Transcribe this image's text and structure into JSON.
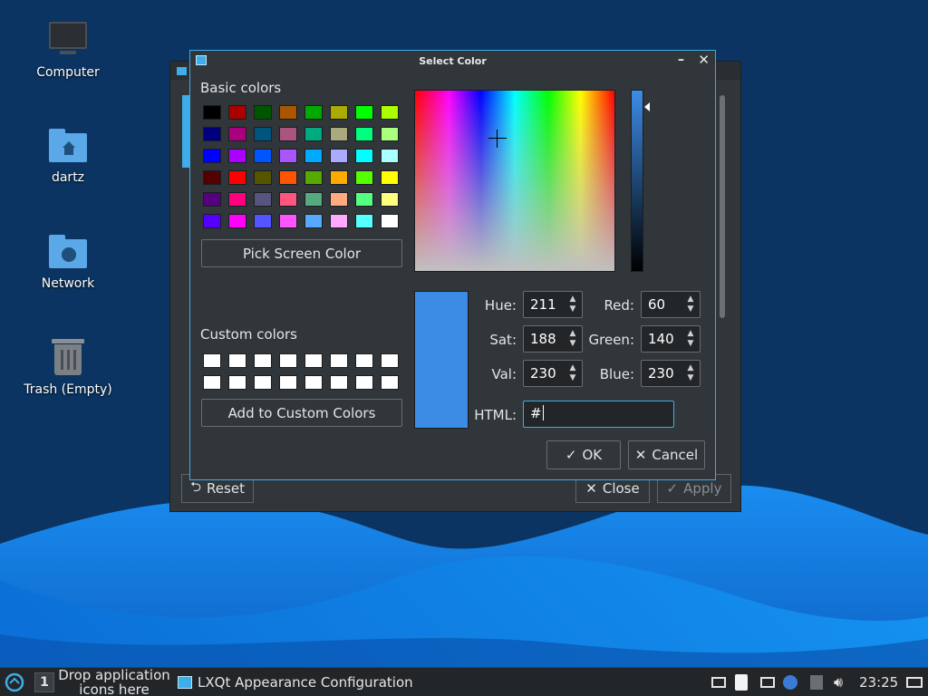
{
  "desktop": {
    "icons": [
      {
        "label": "Computer",
        "icon": "computer-icon"
      },
      {
        "label": "dartz",
        "icon": "home-folder-icon"
      },
      {
        "label": "Network",
        "icon": "network-folder-icon"
      },
      {
        "label": "Trash (Empty)",
        "icon": "trash-icon"
      }
    ]
  },
  "background_window": {
    "title": "LXQt Appearance Configuration",
    "reset_label": "Reset",
    "close_label": "Close",
    "apply_label": "Apply"
  },
  "dialog": {
    "title": "Select Color",
    "basic_colors_label": "Basic colors",
    "basic_colors": [
      "#000000",
      "#aa0000",
      "#005500",
      "#aa5500",
      "#00aa00",
      "#aaaa00",
      "#00ff00",
      "#aaff00",
      "#00007f",
      "#aa007f",
      "#00557f",
      "#aa557f",
      "#00aa7f",
      "#aaaa7f",
      "#00ff7f",
      "#aaff7f",
      "#0000ff",
      "#aa00ff",
      "#0055ff",
      "#aa55ff",
      "#00aaff",
      "#aaaaff",
      "#00ffff",
      "#aaffff",
      "#550000",
      "#ff0000",
      "#555500",
      "#ff5500",
      "#55aa00",
      "#ffaa00",
      "#55ff00",
      "#ffff00",
      "#55007f",
      "#ff007f",
      "#55557f",
      "#ff557f",
      "#55aa7f",
      "#ffaa7f",
      "#55ff7f",
      "#ffff7f",
      "#5500ff",
      "#ff00ff",
      "#5555ff",
      "#ff55ff",
      "#55aaff",
      "#ffaaff",
      "#55ffff",
      "#ffffff"
    ],
    "pick_screen_label": "Pick Screen Color",
    "custom_colors_label": "Custom colors",
    "custom_colors": [
      "#ffffff",
      "#ffffff",
      "#ffffff",
      "#ffffff",
      "#ffffff",
      "#ffffff",
      "#ffffff",
      "#ffffff",
      "#ffffff",
      "#ffffff",
      "#ffffff",
      "#ffffff",
      "#ffffff",
      "#ffffff",
      "#ffffff",
      "#ffffff"
    ],
    "add_custom_label": "Add to Custom Colors",
    "current_color": "#3c8ce6",
    "hue_label": "Hue:",
    "hue": "211",
    "sat_label": "Sat:",
    "sat": "188",
    "val_label": "Val:",
    "val": "230",
    "red_label": "Red:",
    "red": "60",
    "green_label": "Green:",
    "green": "140",
    "blue_label": "Blue:",
    "blue": "230",
    "html_label": "HTML:",
    "html_value": "#",
    "ok_label": "OK",
    "cancel_label": "Cancel"
  },
  "taskbar": {
    "desktop_number": "1",
    "quicklaunch_text": "Drop application icons here",
    "quicklaunch_line1": "Drop application",
    "quicklaunch_line2": "icons here",
    "task_title": "LXQt Appearance Configuration",
    "clock": "23:25"
  },
  "colors": {
    "accent": "#3daee9",
    "panel_bg": "#31363b",
    "taskbar_bg": "#232629"
  }
}
